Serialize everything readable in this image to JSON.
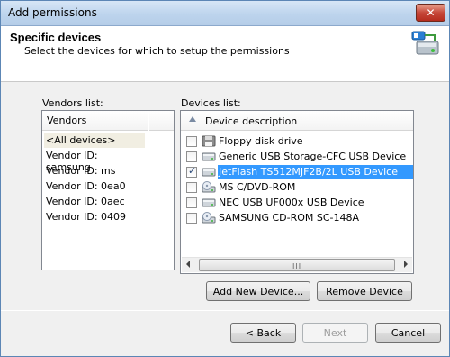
{
  "window": {
    "title": "Add permissions",
    "close_glyph": "✕"
  },
  "header": {
    "title": "Specific devices",
    "subtitle": "Select the devices for which to setup  the permissions",
    "icon": "usb-device-icon"
  },
  "vendors": {
    "label": "Vendors list:",
    "column": "Vendors",
    "items": [
      {
        "label": "<All devices>",
        "selected": true
      },
      {
        "label": "Vendor ID: samsung"
      },
      {
        "label": "Vendor ID: ms"
      },
      {
        "label": "Vendor ID: 0ea0"
      },
      {
        "label": "Vendor ID: 0aec"
      },
      {
        "label": "Vendor ID: 0409"
      }
    ]
  },
  "devices": {
    "label": "Devices list:",
    "column": "Device description",
    "items": [
      {
        "label": "Floppy disk drive",
        "checked": false,
        "icon": "floppy-drive-icon"
      },
      {
        "label": "Generic USB Storage-CFC USB Device",
        "checked": false,
        "icon": "disk-drive-icon"
      },
      {
        "label": "JetFlash TS512MJF2B/2L USB Device",
        "checked": true,
        "selected": true,
        "icon": "disk-drive-icon"
      },
      {
        "label": "MS C/DVD-ROM",
        "checked": false,
        "icon": "cd-drive-icon"
      },
      {
        "label": "NEC USB UF000x USB Device",
        "checked": false,
        "icon": "disk-drive-icon"
      },
      {
        "label": "SAMSUNG CD-ROM SC-148A",
        "checked": false,
        "icon": "cd-drive-icon"
      }
    ],
    "scroll_grip": "III"
  },
  "buttons": {
    "add_device": "Add New Device...",
    "remove_device": "Remove Device",
    "back": "< Back",
    "next": "Next",
    "cancel": "Cancel"
  }
}
